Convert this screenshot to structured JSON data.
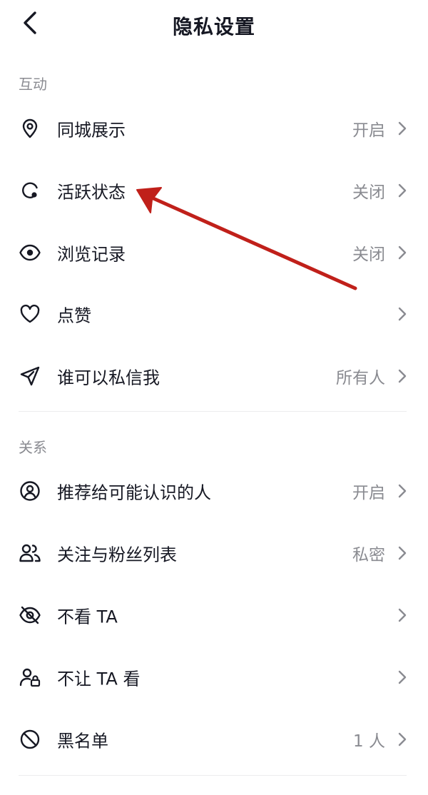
{
  "header": {
    "title": "隐私设置"
  },
  "sections": [
    {
      "title": "互动",
      "items": [
        {
          "label": "同城展示",
          "value": "开启",
          "icon": "location-pin-icon"
        },
        {
          "label": "活跃状态",
          "value": "关闭",
          "icon": "active-status-icon"
        },
        {
          "label": "浏览记录",
          "value": "关闭",
          "icon": "eye-icon"
        },
        {
          "label": "点赞",
          "value": "",
          "icon": "heart-icon"
        },
        {
          "label": "谁可以私信我",
          "value": "所有人",
          "icon": "paper-plane-icon"
        }
      ]
    },
    {
      "title": "关系",
      "items": [
        {
          "label": "推荐给可能认识的人",
          "value": "开启",
          "icon": "user-circle-icon"
        },
        {
          "label": "关注与粉丝列表",
          "value": "私密",
          "icon": "users-icon"
        },
        {
          "label": "不看 TA",
          "value": "",
          "icon": "eye-off-icon"
        },
        {
          "label": "不让 TA 看",
          "value": "",
          "icon": "user-lock-icon"
        },
        {
          "label": "黑名单",
          "value": "1 人",
          "icon": "block-icon"
        }
      ]
    }
  ],
  "colors": {
    "text_primary": "#161823",
    "text_secondary": "#8a8b91",
    "annotation_arrow": "#c0201a"
  }
}
